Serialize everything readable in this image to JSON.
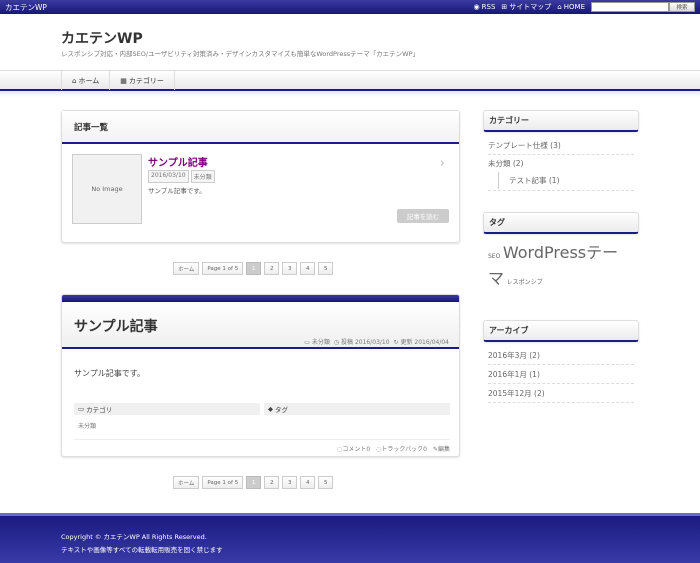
{
  "topbar": {
    "site_name": "カエテンWP",
    "rss": "RSS",
    "sitemap": "サイトマップ",
    "home": "HOME",
    "search_placeholder": "",
    "search_button": "検索"
  },
  "header": {
    "title": "カエテンWP",
    "description": "レスポンシブ対応・内部SEO/ユーザビリティ対策済み・デザインカスタマイズも簡単なWordPressテーマ「カエテンWP」"
  },
  "nav": {
    "items": [
      {
        "label": "ホーム",
        "icon": "home-icon"
      },
      {
        "label": "カテゴリー",
        "icon": "grid-icon"
      }
    ]
  },
  "archive": {
    "heading": "記事一覧",
    "post": {
      "thumb": "No Image",
      "title": "サンプル記事",
      "date": "2016/03/10",
      "category": "未分類",
      "excerpt": "サンプル記事です。",
      "read_more": "記事を読む"
    }
  },
  "pager": {
    "home": "ホーム",
    "info": "Page 1 of 5",
    "pages": [
      "1",
      "2",
      "3",
      "4",
      "5"
    ]
  },
  "article": {
    "title": "サンプル記事",
    "category": "未分類",
    "posted": "投稿 2016/03/10",
    "updated": "更新 2016/04/04",
    "content": "サンプル記事です。",
    "category_label": "カテゴリ",
    "tag_label": "タグ",
    "category_value": "未分類",
    "comments": "コメント0",
    "trackbacks": "トラックバック0",
    "edit": "編集"
  },
  "sidebar": {
    "categories": {
      "heading": "カテゴリー",
      "items": [
        "テンプレート仕様 (3)",
        "未分類 (2)"
      ],
      "sub_item": "テスト記事 (1)"
    },
    "tags": {
      "heading": "タグ",
      "items": [
        "SEO",
        "WordPressテーマ",
        "レスポンシブ"
      ]
    },
    "archives": {
      "heading": "アーカイブ",
      "items": [
        "2016年3月 (2)",
        "2016年1月 (1)",
        "2015年12月 (2)"
      ]
    }
  },
  "footer": {
    "copyright": "Copyright © カエテンWP All Rights Reserved.",
    "notice": "テキストや画像等すべての転載転用販売を固く禁じます"
  }
}
